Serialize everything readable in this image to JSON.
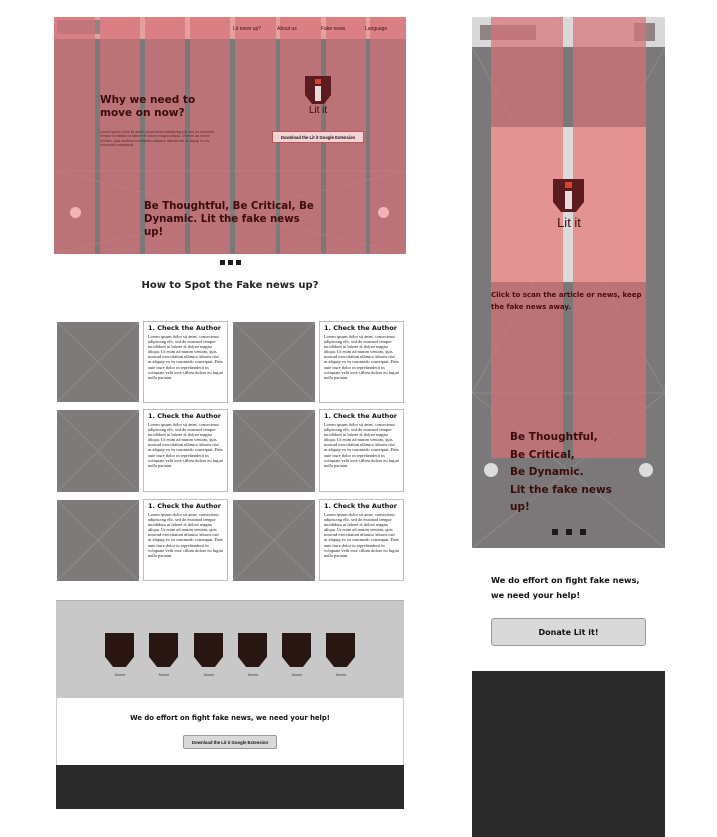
{
  "colors": {
    "column_overlay": "#d67278",
    "hero_background": "#7a7878",
    "header_band": "#e6a0a0",
    "logo_dark": "#5a1c1e",
    "logo_accent": "#d8452e",
    "heading_text": "#3a0c0c",
    "team_band": "#c8c8c8",
    "footer": "#2a2a2a",
    "shield": "#271612"
  },
  "desktop": {
    "nav": {
      "items": [
        "Lit news up?",
        "About us",
        "Fake news",
        "Language"
      ]
    },
    "hero": {
      "heading": "Why we need to move on now?",
      "body": "Lorem ipsum dolor sit amet, consectetur adipiscing elit, sed do eiusmod tempor incididunt ut labore et dolore magna aliqua. Ut enim ad minim veniam, quis nostrud exercitation ullamco laboris nisi ut aliquip ex ea commodo consequat.",
      "logo_text": "Lit it",
      "cta_label": "Download the Lit it Google Extension",
      "slogan": "Be Thoughtful, Be Critical, Be Dynamic. Lit the fake news up!"
    },
    "section_title": "How to Spot the Fake news up?",
    "cards": [
      {
        "title": "1. Check the Author",
        "body": "Lorem ipsum dolor sit amet, consectetur adipiscing elit, sed do eiusmod tempor incididunt ut labore et dolore magna aliqua. Ut enim ad minim veniam, quis nostrud exercitation ullamco laboris nisi ut aliquip ex ea commodo consequat. Duis aute irure dolor in reprehenderit in voluptate velit esse cillum dolore eu fugiat nulla pariatur."
      },
      {
        "title": "1. Check the Author",
        "body": "Lorem ipsum dolor sit amet, consectetur adipiscing elit, sed do eiusmod tempor incididunt ut labore et dolore magna aliqua. Ut enim ad minim veniam, quis nostrud exercitation ullamco laboris nisi ut aliquip ex ea commodo consequat. Duis aute irure dolor in reprehenderit in voluptate velit esse cillum dolore eu fugiat nulla pariatur."
      },
      {
        "title": "1. Check the Author",
        "body": "Lorem ipsum dolor sit amet, consectetur adipiscing elit, sed do eiusmod tempor incididunt ut labore et dolore magna aliqua. Ut enim ad minim veniam, quis nostrud exercitation ullamco laboris nisi ut aliquip ex ea commodo consequat. Duis aute irure dolor in reprehenderit in voluptate velit esse cillum dolore eu fugiat nulla pariatur."
      },
      {
        "title": "1. Check the Author",
        "body": "Lorem ipsum dolor sit amet, consectetur adipiscing elit, sed do eiusmod tempor incididunt ut labore et dolore magna aliqua. Ut enim ad minim veniam, quis nostrud exercitation ullamco laboris nisi ut aliquip ex ea commodo consequat. Duis aute irure dolor in reprehenderit in voluptate velit esse cillum dolore eu fugiat nulla pariatur."
      },
      {
        "title": "1. Check the Author",
        "body": "Lorem ipsum dolor sit amet, consectetur adipiscing elit, sed do eiusmod tempor incididunt ut labore et dolore magna aliqua. Ut enim ad minim veniam, quis nostrud exercitation ullamco laboris nisi ut aliquip ex ea commodo consequat. Duis aute irure dolor in reprehenderit in voluptate velit esse cillum dolore eu fugiat nulla pariatur."
      },
      {
        "title": "1. Check the Author",
        "body": "Lorem ipsum dolor sit amet, consectetur adipiscing elit, sed do eiusmod tempor incididunt ut labore et dolore magna aliqua. Ut enim ad minim veniam, quis nostrud exercitation ullamco laboris nisi ut aliquip ex ea commodo consequat. Duis aute irure dolor in reprehenderit in voluptate velit esse cillum dolore eu fugiat nulla pariatur."
      }
    ],
    "team": {
      "names": [
        "Name",
        "Name",
        "Name",
        "Name",
        "Name",
        "Name"
      ]
    },
    "help_text": "We do effort on fight fake news, we need your help!",
    "cta2_label": "Download the Lit it Google Extension"
  },
  "mobile": {
    "logo_text": "Lit it",
    "scan_text": "Click to scan the article or news, keep the fake news away.",
    "slogan_lines": [
      "Be Thoughtful,",
      "Be Critical,",
      "Be Dynamic.",
      "Lit the fake news",
      "up!"
    ],
    "help_line1": "We do effort on fight fake news,",
    "help_line2": "we need your help!",
    "donate_label": "Donate Lit it!"
  }
}
